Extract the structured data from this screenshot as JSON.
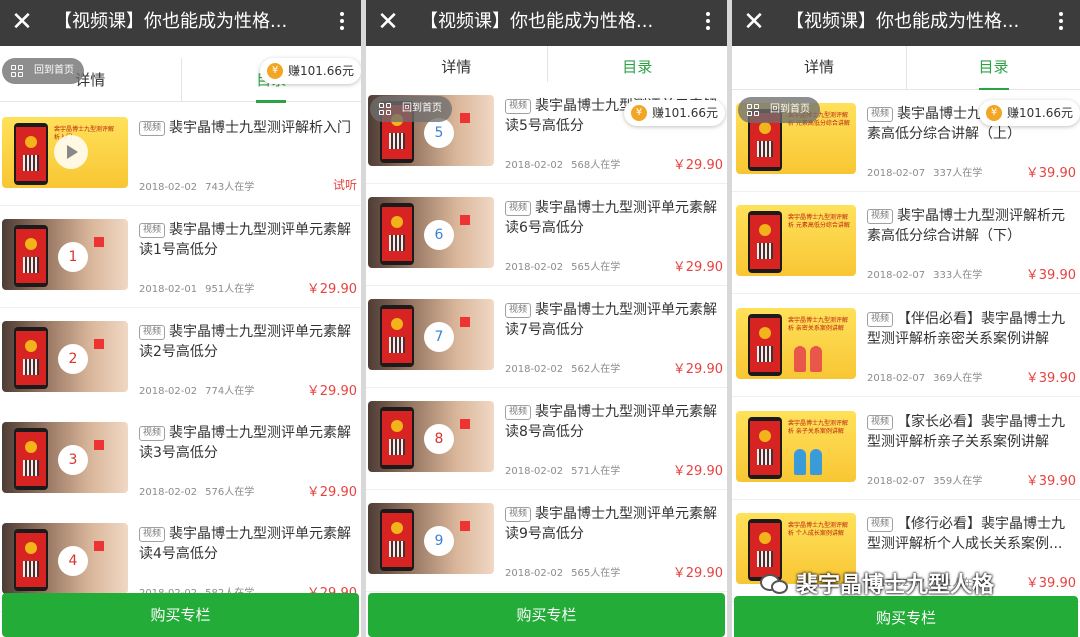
{
  "app": {
    "title": "【视频课】你也能成为性格...",
    "buy_label": "购买专栏",
    "home_label": "回到首页",
    "earn_label": "赚101.66元",
    "tab_detail": "详情",
    "tab_catalog": "目录",
    "badge": "视频",
    "accent_color": "#2ba245",
    "price_color": "#e64340"
  },
  "panel1": {
    "items": [
      {
        "title": "裴宇晶博士九型测评解析入门",
        "date": "2018-02-02",
        "count": "743人在学",
        "price": "试听",
        "thumb_cap": "裴宇晶博士九型测评解析入门"
      },
      {
        "title": "裴宇晶博士九型测评单元素解读1号高低分",
        "date": "2018-02-01",
        "count": "951人在学",
        "price": "￥29.90",
        "num": "1"
      },
      {
        "title": "裴宇晶博士九型测评单元素解读2号高低分",
        "date": "2018-02-02",
        "count": "774人在学",
        "price": "￥29.90",
        "num": "2"
      },
      {
        "title": "裴宇晶博士九型测评单元素解读3号高低分",
        "date": "2018-02-02",
        "count": "576人在学",
        "price": "￥29.90",
        "num": "3"
      },
      {
        "title": "裴宇晶博士九型测评单元素解读4号高低分",
        "date": "2018-02-02",
        "count": "582人在学",
        "price": "￥29.90",
        "num": "4"
      }
    ]
  },
  "panel2": {
    "items": [
      {
        "title": "裴宇晶博士九型测评单元素解读5号高低分",
        "date": "2018-02-02",
        "count": "568人在学",
        "price": "￥29.90",
        "num": "5"
      },
      {
        "title": "裴宇晶博士九型测评单元素解读6号高低分",
        "date": "2018-02-02",
        "count": "565人在学",
        "price": "￥29.90",
        "num": "6"
      },
      {
        "title": "裴宇晶博士九型测评单元素解读7号高低分",
        "date": "2018-02-02",
        "count": "562人在学",
        "price": "￥29.90",
        "num": "7"
      },
      {
        "title": "裴宇晶博士九型测评单元素解读8号高低分",
        "date": "2018-02-02",
        "count": "571人在学",
        "price": "￥29.90",
        "num": "8"
      },
      {
        "title": "裴宇晶博士九型测评单元素解读9号高低分",
        "date": "2018-02-02",
        "count": "565人在学",
        "price": "￥29.90",
        "num": "9"
      }
    ]
  },
  "panel3": {
    "items": [
      {
        "title": "裴宇晶博士九型测评解析元素高低分综合讲解（上）",
        "date": "2018-02-07",
        "count": "337人在学",
        "price": "￥39.90",
        "thumb_cap": "裴宇晶博士九型测评解析 元素高低分综合讲解"
      },
      {
        "title": "裴宇晶博士九型测评解析元素高低分综合讲解（下）",
        "date": "2018-02-07",
        "count": "333人在学",
        "price": "￥39.90",
        "thumb_cap": "裴宇晶博士九型测评解析 元素高低分综合讲解"
      },
      {
        "title": "【伴侣必看】裴宇晶博士九型测评解析亲密关系案例讲解",
        "date": "2018-02-07",
        "count": "369人在学",
        "price": "￥39.90",
        "thumb_cap": "裴宇晶博士九型测评解析 亲密关系案例讲解"
      },
      {
        "title": "【家长必看】裴宇晶博士九型测评解析亲子关系案例讲解",
        "date": "2018-02-07",
        "count": "359人在学",
        "price": "￥39.90",
        "thumb_cap": "裴宇晶博士九型测评解析 亲子关系案例讲解"
      },
      {
        "title": "【修行必看】裴宇晶博士九型测评解析个人成长关系案例...",
        "date": "2018-02-07",
        "count": "291人在学",
        "price": "￥39.90",
        "thumb_cap": "裴宇晶博士九型测评解析 个人成长案例讲解"
      }
    ]
  },
  "watermark": "裴宇晶博士九型人格"
}
